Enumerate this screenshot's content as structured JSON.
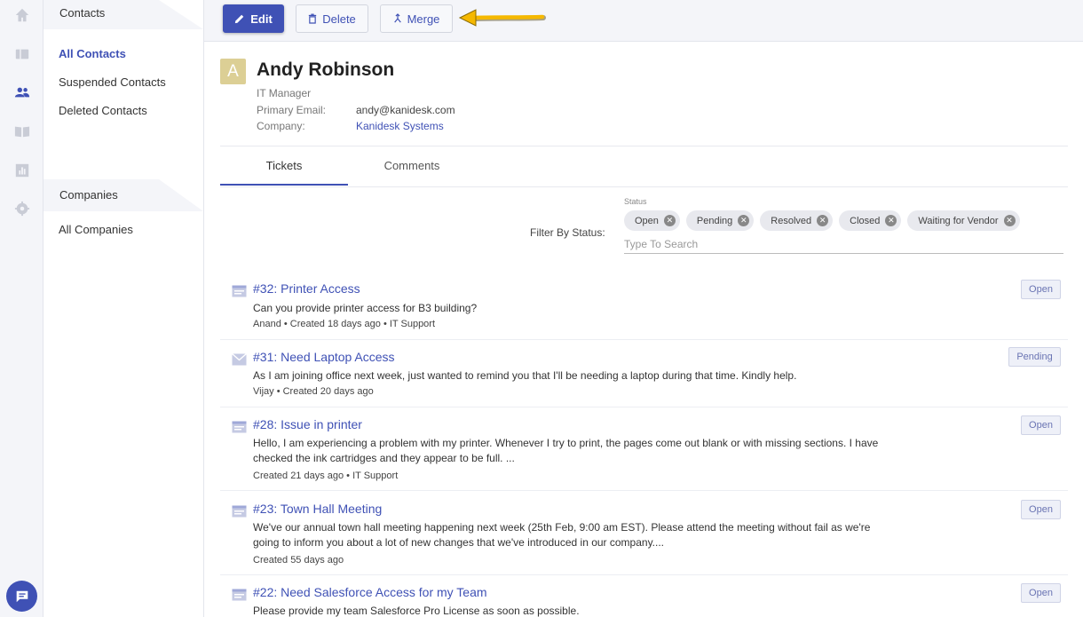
{
  "rail": {
    "icons": [
      "home-icon",
      "tickets-icon",
      "contacts-icon",
      "knowledge-base-icon",
      "reports-icon",
      "settings-icon",
      "chat-icon"
    ],
    "active_color": "#3f51b5"
  },
  "nav": {
    "contacts_heading": "Contacts",
    "contacts_items": [
      {
        "label": "All Contacts",
        "active": true
      },
      {
        "label": "Suspended Contacts",
        "active": false
      },
      {
        "label": "Deleted Contacts",
        "active": false
      }
    ],
    "companies_heading": "Companies",
    "companies_items": [
      {
        "label": "All Companies",
        "active": false
      }
    ]
  },
  "toolbar": {
    "edit_label": "Edit",
    "delete_label": "Delete",
    "merge_label": "Merge",
    "arrow_color": "#f5b800"
  },
  "contact": {
    "initial": "A",
    "name": "Andy Robinson",
    "title": "IT Manager",
    "email_label": "Primary Email:",
    "email": "andy@kanidesk.com",
    "company_label": "Company:",
    "company": "Kanidesk Systems"
  },
  "tabs": [
    {
      "label": "Tickets",
      "active": true
    },
    {
      "label": "Comments",
      "active": false
    }
  ],
  "filter": {
    "label": "Filter By Status:",
    "caption": "Status",
    "chips": [
      "Open",
      "Pending",
      "Resolved",
      "Closed",
      "Waiting for Vendor"
    ],
    "placeholder": "Type To Search"
  },
  "tickets": [
    {
      "icon": "web-ticket-icon",
      "title": "#32: Printer Access",
      "desc": "Can you provide printer access for B3 building?",
      "meta": "Anand  • Created 18 days ago •  IT Support",
      "status": "Open"
    },
    {
      "icon": "email-ticket-icon",
      "title": "#31: Need Laptop Access",
      "desc": "As I am joining office next week, just wanted to remind you that I'll be needing a laptop during that time. Kindly help.",
      "meta": "Vijay  • Created 20 days ago",
      "status": "Pending"
    },
    {
      "icon": "web-ticket-icon",
      "title": "#28: Issue in printer",
      "desc": "Hello, I am experiencing a problem with my printer. Whenever I try to print, the pages come out blank or with missing sections. I have checked the ink cartridges and they appear to be full. ...",
      "meta": "Created 21 days ago •  IT Support",
      "status": "Open"
    },
    {
      "icon": "web-ticket-icon",
      "title": "#23: Town Hall Meeting",
      "desc": "We've our annual town hall meeting happening next week (25th Feb, 9:00 am EST). Please attend the meeting without fail as we're going to inform you about a lot of new changes that we've introduced in our company....",
      "meta": "Created 55 days ago",
      "status": "Open"
    },
    {
      "icon": "web-ticket-icon",
      "title": "#22: Need Salesforce Access for my Team",
      "desc": "Please provide my team Salesforce Pro License as soon as possible.",
      "meta": "",
      "status": "Open"
    }
  ]
}
